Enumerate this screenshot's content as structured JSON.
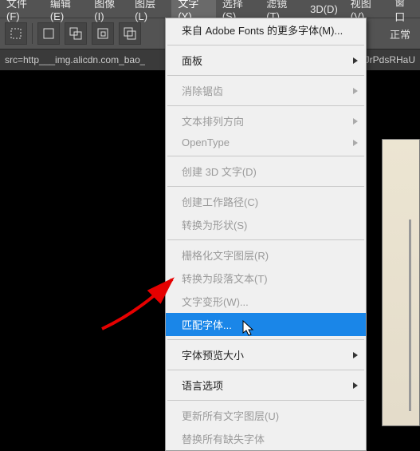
{
  "menubar": {
    "items": [
      {
        "label": "文件(F)"
      },
      {
        "label": "编辑(E)"
      },
      {
        "label": "图像(I)"
      },
      {
        "label": "图层(L)"
      },
      {
        "label": "文字(Y)",
        "active": true
      },
      {
        "label": "选择(S)"
      },
      {
        "label": "滤镜(T)"
      },
      {
        "label": "3D(D)"
      },
      {
        "label": "视图(V)"
      },
      {
        "label": "窗口"
      }
    ]
  },
  "toolbar": {
    "mode_label": "正常"
  },
  "tabbar": {
    "tab1": "src=http___img.alicdn.com_bao_",
    "tab1_suffix": "JrPdsRHaU"
  },
  "dropdown": {
    "items": [
      {
        "label": "来自 Adobe Fonts 的更多字体(M)..."
      },
      {
        "sep": true
      },
      {
        "label": "面板",
        "arrow": true
      },
      {
        "sep": true
      },
      {
        "label": "消除锯齿",
        "arrow": true,
        "disabled": true
      },
      {
        "sep": true
      },
      {
        "label": "文本排列方向",
        "arrow": true,
        "disabled": true
      },
      {
        "label": "OpenType",
        "arrow": true,
        "disabled": true
      },
      {
        "sep": true
      },
      {
        "label": "创建 3D 文字(D)",
        "disabled": true
      },
      {
        "sep": true
      },
      {
        "label": "创建工作路径(C)",
        "disabled": true
      },
      {
        "label": "转换为形状(S)",
        "disabled": true
      },
      {
        "sep": true
      },
      {
        "label": "栅格化文字图层(R)",
        "disabled": true
      },
      {
        "label": "转换为段落文本(T)",
        "disabled": true
      },
      {
        "label": "文字变形(W)...",
        "disabled": true
      },
      {
        "label": "匹配字体...",
        "highlighted": true
      },
      {
        "sep": true
      },
      {
        "label": "字体预览大小",
        "arrow": true
      },
      {
        "sep": true
      },
      {
        "label": "语言选项",
        "arrow": true
      },
      {
        "sep": true
      },
      {
        "label": "更新所有文字图层(U)",
        "disabled": true
      },
      {
        "label": "替换所有缺失字体",
        "disabled": true
      }
    ]
  }
}
